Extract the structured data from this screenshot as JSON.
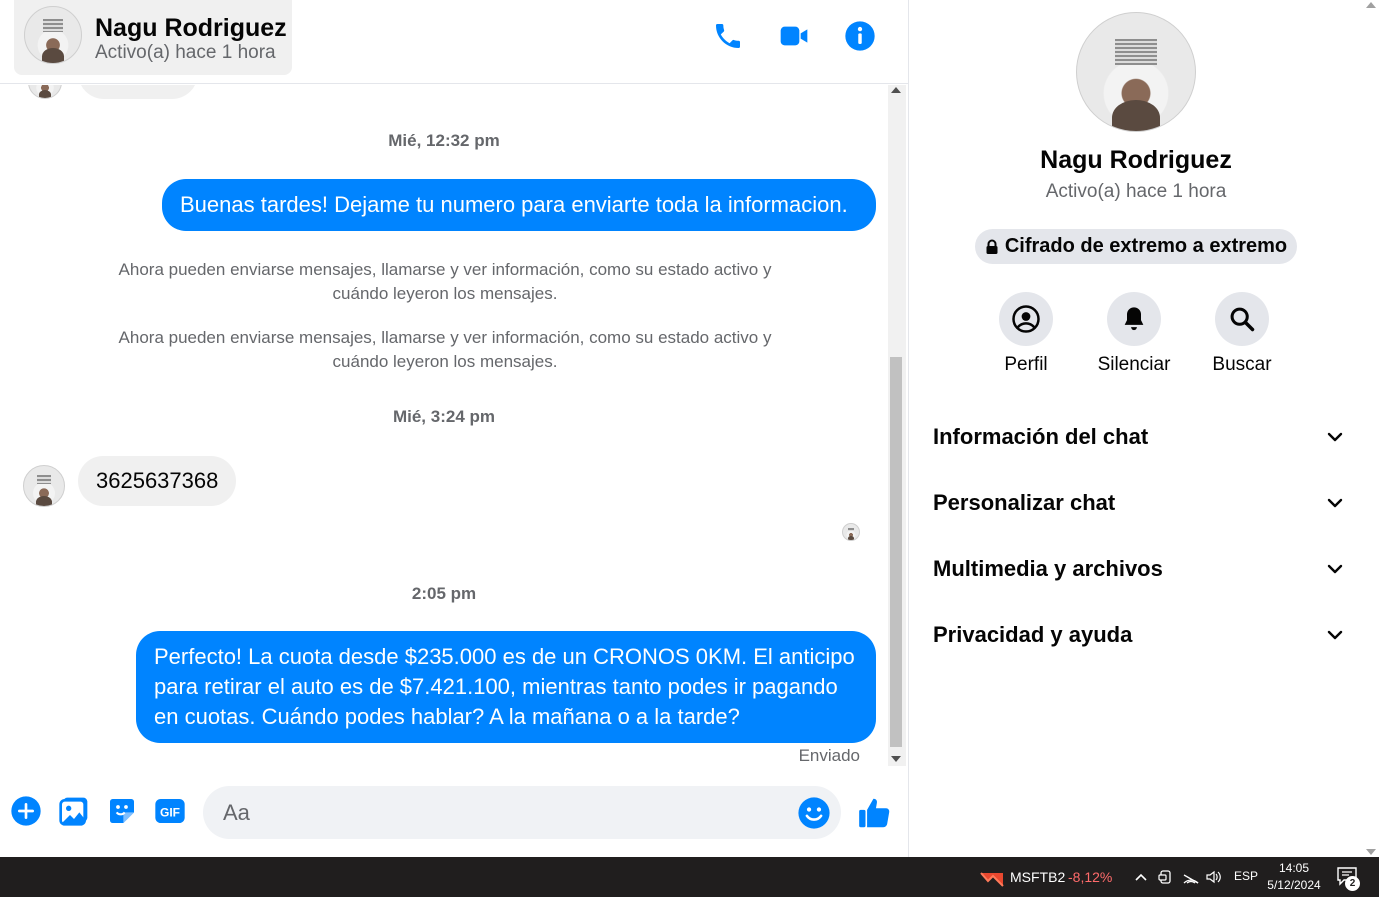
{
  "header": {
    "contact_name": "Nagu Rodriguez",
    "contact_status": "Activo(a) hace 1 hora"
  },
  "colors": {
    "accent": "#0084ff",
    "incoming_bubble": "#f0f0f0",
    "meta_text": "#65676b"
  },
  "messages": {
    "timestamp_1": "Mié, 12:32 pm",
    "outgoing_1": "Buenas tardes! Dejame tu numero para enviarte toda la informacion.",
    "system_1": "Ahora pueden enviarse mensajes, llamarse y ver información, como su estado activo y cuándo leyeron los mensajes.",
    "system_2": "Ahora pueden enviarse mensajes, llamarse y ver información, como su estado activo y cuándo leyeron los mensajes.",
    "timestamp_2": "Mié, 3:24 pm",
    "incoming_1": "3625637368",
    "timestamp_3": "2:05 pm",
    "outgoing_2": "Perfecto! La cuota desde $235.000 es de un CRONOS 0KM. El anticipo para retirar el auto es de $7.421.100, mientras tanto podes ir pagando en cuotas. Cuándo podes hablar? A la mañana o a la tarde?",
    "sent_status": "Enviado"
  },
  "composer": {
    "placeholder": "Aa"
  },
  "info_panel": {
    "name": "Nagu Rodriguez",
    "status": "Activo(a) hace 1 hora",
    "e2e_label": "Cifrado de extremo a extremo",
    "actions": {
      "profile": "Perfil",
      "mute": "Silenciar",
      "search": "Buscar"
    },
    "sections": {
      "chat_info": "Información del chat",
      "customize": "Personalizar chat",
      "media": "Multimedia y archivos",
      "privacy": "Privacidad y ayuda"
    }
  },
  "taskbar": {
    "stock_symbol": "MSFTB2",
    "stock_change": "-8,12%",
    "language": "ESP",
    "time": "14:05",
    "date": "5/12/2024",
    "notification_count": "2"
  }
}
